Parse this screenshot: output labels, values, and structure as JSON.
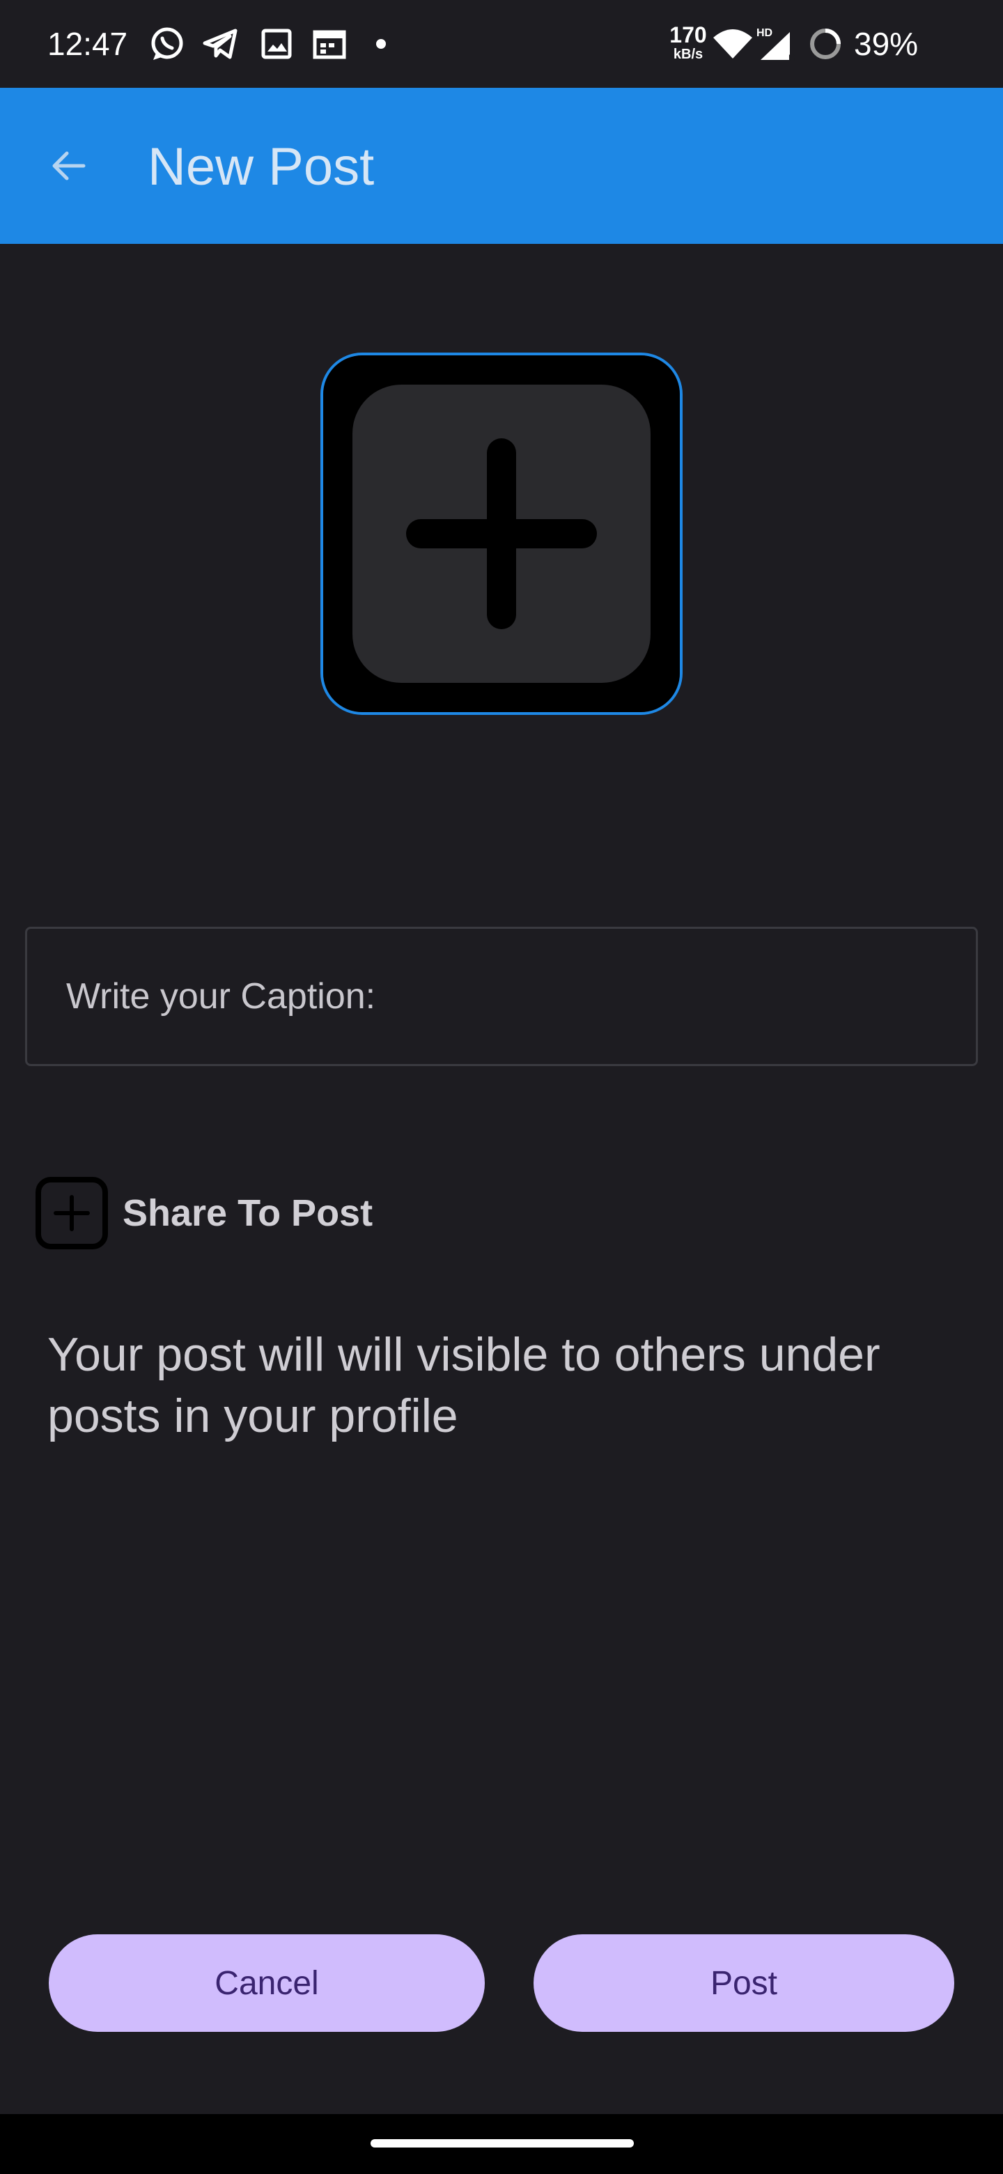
{
  "status_bar": {
    "time": "12:47",
    "net_speed_value": "170",
    "net_speed_unit": "kB/s",
    "battery_percent": "39%",
    "icons": [
      "whatsapp-icon",
      "telegram-icon",
      "gallery-icon",
      "calendar-icon",
      "notification-dot",
      "wifi-icon",
      "hd-signal-icon",
      "battery-saver-icon"
    ]
  },
  "app_bar": {
    "title": "New Post",
    "back_icon": "arrow-back-icon"
  },
  "image_picker": {
    "icon": "add-box-icon",
    "border_color": "#1e88e5"
  },
  "caption": {
    "placeholder": "Write your Caption:",
    "value": ""
  },
  "share": {
    "label": "Share To Post",
    "icon": "add-box-icon"
  },
  "info_text": "Your post will will visible to others under posts in your profile",
  "actions": {
    "cancel_label": "Cancel",
    "post_label": "Post"
  },
  "colors": {
    "app_bar": "#1e88e5",
    "background": "#1d1c21",
    "button_bg": "#d0bcfd",
    "button_text": "#3a2470"
  }
}
